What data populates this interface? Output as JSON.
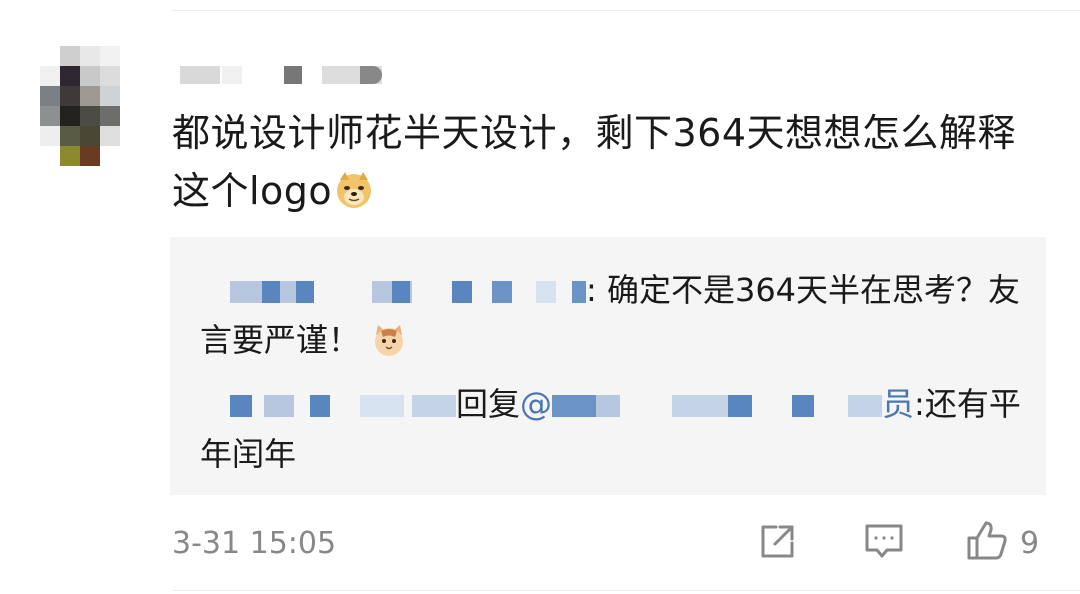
{
  "comment": {
    "text": "都说设计师花半天设计，剩下364天想想怎么解释这个logo",
    "emoji": "doge-emoji"
  },
  "replies": [
    {
      "separator": ": ",
      "text": "确定不是364天半在思考？友言要严谨！",
      "emoji": "cat-face-emoji"
    },
    {
      "reply_word": "回复",
      "at": "@",
      "role_suffix": "员",
      "text": ":还有平年闰年"
    }
  ],
  "footer": {
    "timestamp": "3-31 15:05",
    "like_count": "9",
    "icons": [
      "share-icon",
      "comment-icon",
      "like-icon"
    ]
  },
  "colors": {
    "link": "#4a77b4",
    "meta": "#888888",
    "reply_bg": "#f5f5f5"
  }
}
